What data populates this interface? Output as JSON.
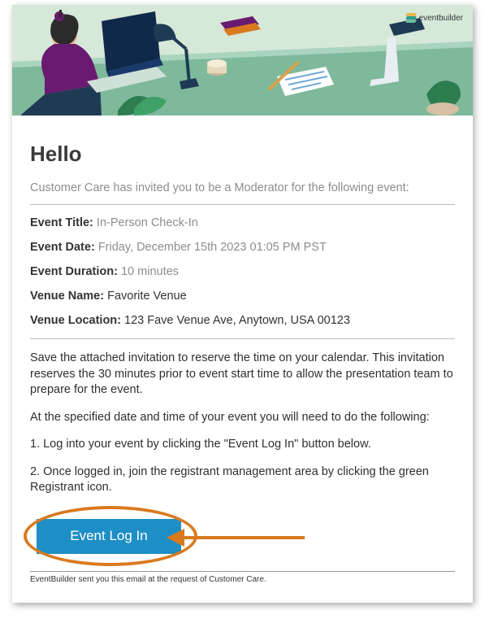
{
  "brand": {
    "name": "eventbuilder"
  },
  "greeting": "Hello",
  "intro": "Customer Care has invited you to be a Moderator for the following event:",
  "details": {
    "title": {
      "label": "Event Title:",
      "value": "In-Person Check-In",
      "muted": true
    },
    "date": {
      "label": "Event Date:",
      "value": "Friday, December 15th 2023 01:05 PM PST",
      "muted": true
    },
    "duration": {
      "label": "Event Duration:",
      "value": "10 minutes",
      "muted": true
    },
    "venue_name": {
      "label": "Venue Name:",
      "value": "Favorite Venue",
      "muted": false
    },
    "venue_location": {
      "label": "Venue Location:",
      "value": "123 Fave Venue Ave, Anytown, USA 00123",
      "muted": false
    }
  },
  "body": {
    "p1": "Save the attached invitation to reserve the time on your calendar. This invitation reserves the 30 minutes prior to event start time to allow the presentation team to prepare for the event.",
    "p2": "At the specified date and time of your event you will need to do the following:",
    "step1": "1. Log into your event by clicking the \"Event Log In\" button below.",
    "step2": "2. Once logged in, join the registrant management area by clicking the green Registrant icon."
  },
  "cta": {
    "label": "Event Log In"
  },
  "footer": "EventBuilder sent you this email at the request of Customer Care.",
  "colors": {
    "accent_button": "#1e8fc6",
    "annotation": "#d97a1f",
    "muted_text": "#8d8d8d"
  }
}
